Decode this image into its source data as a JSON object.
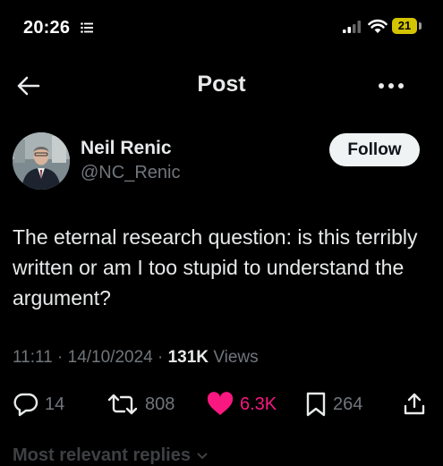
{
  "status_bar": {
    "time": "20:26",
    "battery": "21"
  },
  "header": {
    "title": "Post"
  },
  "author": {
    "name": "Neil Renic",
    "handle": "@NC_Renic",
    "follow_label": "Follow"
  },
  "post": {
    "text": "The eternal research question: is this terribly written or am I too stupid to understand the argument?",
    "time": "11:11",
    "date": "14/10/2024",
    "views_count": "131K",
    "views_label": "Views",
    "separator": "·"
  },
  "actions": {
    "replies": "14",
    "reposts": "808",
    "likes": "6.3K",
    "bookmarks": "264"
  },
  "replies_section": {
    "label": "Most relevant replies"
  },
  "colors": {
    "background": "#000000",
    "text": "#e7e9ea",
    "muted": "#71767b",
    "like": "#f91880",
    "battery": "#d4c400"
  },
  "icons": [
    "list-icon",
    "signal-icon",
    "wifi-icon",
    "battery-icon",
    "back-arrow-icon",
    "more-icon",
    "reply-icon",
    "repost-icon",
    "like-icon",
    "bookmark-icon",
    "share-icon",
    "chevron-down-icon"
  ]
}
